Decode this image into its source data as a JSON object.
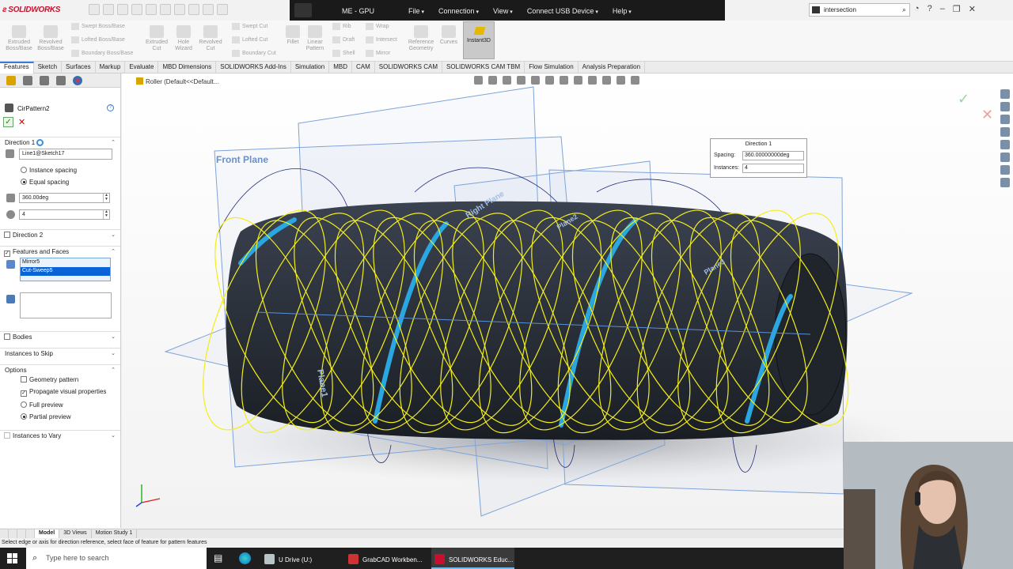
{
  "app": {
    "logo_text": "SOLIDWORKS",
    "remote_title": "ME - GPU",
    "remote_menu": [
      "File",
      "Connection",
      "View",
      "Connect USB Device",
      "Help"
    ],
    "search_value": "intersection"
  },
  "command_manager": {
    "big": [
      {
        "label": "Extruded Boss/Base"
      },
      {
        "label": "Revolved Boss/Base"
      },
      {
        "label": "Extruded Cut"
      },
      {
        "label": "Hole Wizard"
      },
      {
        "label": "Revolved Cut"
      },
      {
        "label": "Fillet"
      },
      {
        "label": "Linear Pattern"
      },
      {
        "label": "Reference Geometry"
      },
      {
        "label": "Curves"
      },
      {
        "label": "Instant3D"
      }
    ],
    "small": [
      "Swept Boss/Base",
      "Lofted Boss/Base",
      "Boundary Boss/Base",
      "Swept Cut",
      "Lofted Cut",
      "Boundary Cut",
      "Rib",
      "Draft",
      "Shell",
      "Wrap",
      "Intersect",
      "Mirror"
    ]
  },
  "tabs": [
    "Features",
    "Sketch",
    "Surfaces",
    "Markup",
    "Evaluate",
    "MBD Dimensions",
    "SOLIDWORKS Add-Ins",
    "Simulation",
    "MBD",
    "CAM",
    "SOLIDWORKS CAM",
    "SOLIDWORKS CAM TBM",
    "Flow Simulation",
    "Analysis Preparation"
  ],
  "property_manager": {
    "title": "CirPattern2",
    "direction1": {
      "label": "Direction 1",
      "axis_value": "Line1@Sketch17",
      "instance_spacing": "Instance spacing",
      "equal_spacing": "Equal spacing",
      "angle_value": "360.00deg",
      "count_value": "4"
    },
    "direction2_label": "Direction 2",
    "features_faces": {
      "label": "Features and Faces",
      "items": [
        "Mirror5",
        "Cut-Sweep5"
      ]
    },
    "bodies_label": "Bodies",
    "instances_to_skip": "Instances to Skip",
    "options": {
      "label": "Options",
      "geometry_pattern": "Geometry pattern",
      "propagate": "Propagate visual properties",
      "full_preview": "Full preview",
      "partial_preview": "Partial preview"
    },
    "instances_to_vary": "Instances to Vary"
  },
  "viewport": {
    "breadcrumb": "Roller  (Default<<Default...",
    "plane_labels": [
      "Front Plane",
      "Right Plane",
      "Plane1",
      "Plane2",
      "Plane3",
      "Plane1"
    ],
    "callout": {
      "title": "Direction 1",
      "spacing_label": "Spacing:",
      "spacing_value": "360.00000000deg",
      "instances_label": "Instances:",
      "instances_value": "4"
    }
  },
  "model_tabs": [
    "Model",
    "3D Views",
    "Motion Study 1"
  ],
  "status_text": "Select edge or axis for direction reference, select face of feature for pattern features",
  "taskbar": {
    "search_placeholder": "Type here to search",
    "apps": [
      "U Drive (U:)",
      "GrabCAD Workben...",
      "SOLIDWORKS Educ..."
    ]
  },
  "colors": {
    "accent": "#3a7bd5",
    "selection": "#0a64d6",
    "preview_yellow": "#f2ee1a",
    "plane_blue": "#6d9ad6",
    "sweep_cyan": "#2aa6e0",
    "body": "#2a3038"
  }
}
